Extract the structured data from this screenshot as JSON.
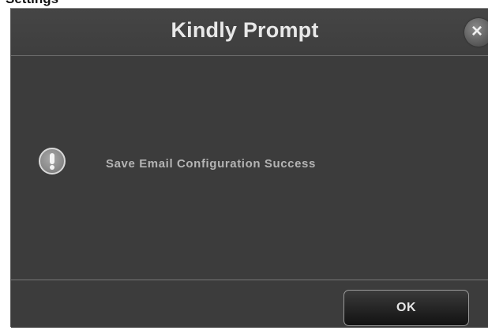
{
  "dialog": {
    "title": "Kindly Prompt",
    "close_label": "×",
    "message": "Save Email Configuration Success",
    "ok_label": "OK",
    "icon": "exclamation-icon"
  },
  "colors": {
    "dialog_background": "#3c3c3c",
    "title_text": "#e8e8e8",
    "message_text": "#b4b4b4",
    "button_background": "#1a1a1a"
  }
}
